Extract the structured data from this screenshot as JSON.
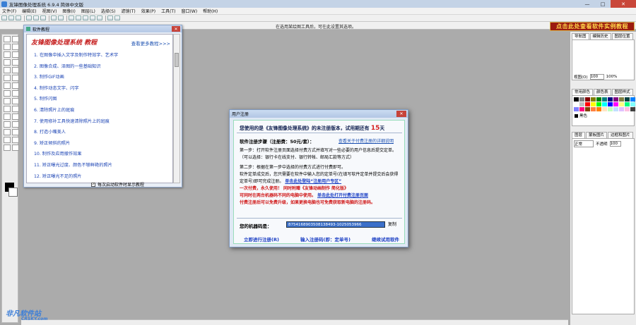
{
  "window": {
    "title": "友锋图像处理系统 6.9.4 简体中文版",
    "min": "—",
    "max": "□",
    "close": "✕"
  },
  "menu": [
    "文件(F)",
    "编辑(E)",
    "视图(V)",
    "图像(I)",
    "图层(L)",
    "选择(S)",
    "滤镜(T)",
    "效果(P)",
    "工具(T)",
    "窗口(W)",
    "帮助(H)"
  ],
  "hint": "在选用某绘图工具后，可在此设置其选项。",
  "banner": "点击此处查看软件实例教程",
  "tutorial": {
    "window_title": "软件教程",
    "close": "✕",
    "heading": "友锋图像处理系统 教程",
    "more": "查看更多教程>>>",
    "items": [
      "1. 在图像中插入文字及制作特效字、艺术字",
      "2. 图像合成、泽图的一些基础知识",
      "3. 制作GIF动画",
      "4. 制作动态文字、闪字",
      "5. 制作闪图",
      "6. 清除照片上的斑痕",
      "7. 使用修补工具快速清除照片上的斑痕",
      "8. 打造小嘴美人",
      "9. 矫正倾斜的照片",
      "10. 制作及应用撤作效果",
      "11. 矫正曝光过度、颜色不够鲜艳的照片",
      "12. 矫正曝光不足的照片"
    ],
    "footer": "每次启动软件时显示教程",
    "footer_check": "✓"
  },
  "register": {
    "title": "用户注册",
    "close": "✕",
    "days_prefix": "您使用的是《友锋图像处理系统》的未注册版本，试用期还有",
    "days_value": "15",
    "days_suffix": "天",
    "steps_label": "软件注册步骤（注册费：50元/套）：",
    "steps_link": "查看关于付费注册的详细说明",
    "step1": "第一步：打开软件注册页面选择付费方式并填写对一些必要的用户信息后提交定单。（可以选择：银行卡在线支付、银行转帐、邮局汇款等方式）",
    "step2a": "第二步：根据在第一步中选择的付费方式进行付费即可。",
    "step2b": "软件定单成交后，您只需要在软件中输入您的定单号(在填写软件定单并提交后会获得定单号)即可完成注册。",
    "link_reg": "单击此处登陆“注册用户专区”",
    "once": "一次付费，永久使用！",
    "gift": "同时附赠《友锋动画制作 简化版》",
    "limit": "可同时在两台机器码不同的电脑中使用。",
    "link_pay": "单击此处打开付费注册页面",
    "renew": "付费注册后可以免费升级，如果更换电脑也可免费获取新电脑的注册码。",
    "machine_label": "您的机器码是：",
    "machine_code": "8754168903508138493-1025053966",
    "copy": "复制",
    "btn_register": "立即进行注册(R)",
    "btn_enter": "输入注册码(即：定单号)",
    "btn_trial": "继续试用软件"
  },
  "right": {
    "tabs_nav": [
      "导航图",
      "编辑历史",
      "图层位置"
    ],
    "zoom_label": "视图(O)",
    "zoom_value": "100",
    "zoom_pct": "100%",
    "tabs_color": [
      "常用颜色",
      "颜色表",
      "图层样式"
    ],
    "fg_color": "黑色",
    "tabs_layers": [
      "图层",
      "蒙板图片",
      "边框和图片"
    ],
    "blend": "正常",
    "opacity_label": "不透明",
    "opacity": "100"
  },
  "watermark": {
    "main": "非凡软件站",
    "sub": "CRSKY.com"
  },
  "palette_colors": [
    "#000000",
    "#808080",
    "#800000",
    "#808000",
    "#008000",
    "#008080",
    "#000080",
    "#800080",
    "#808040",
    "#004040",
    "#0080ff",
    "#ffffff",
    "#c0c0c0",
    "#ff0000",
    "#ffff00",
    "#00ff00",
    "#00ffff",
    "#0000ff",
    "#ff00ff",
    "#ffff80",
    "#00ff80",
    "#80ffff",
    "#8080ff",
    "#ff0080",
    "#804000",
    "#ff8040",
    "#ff8000",
    "#ffe4c4",
    "#c0ffc0",
    "#c0e0ff",
    "#e0c0ff",
    "#ffc0e0",
    "#404040"
  ]
}
